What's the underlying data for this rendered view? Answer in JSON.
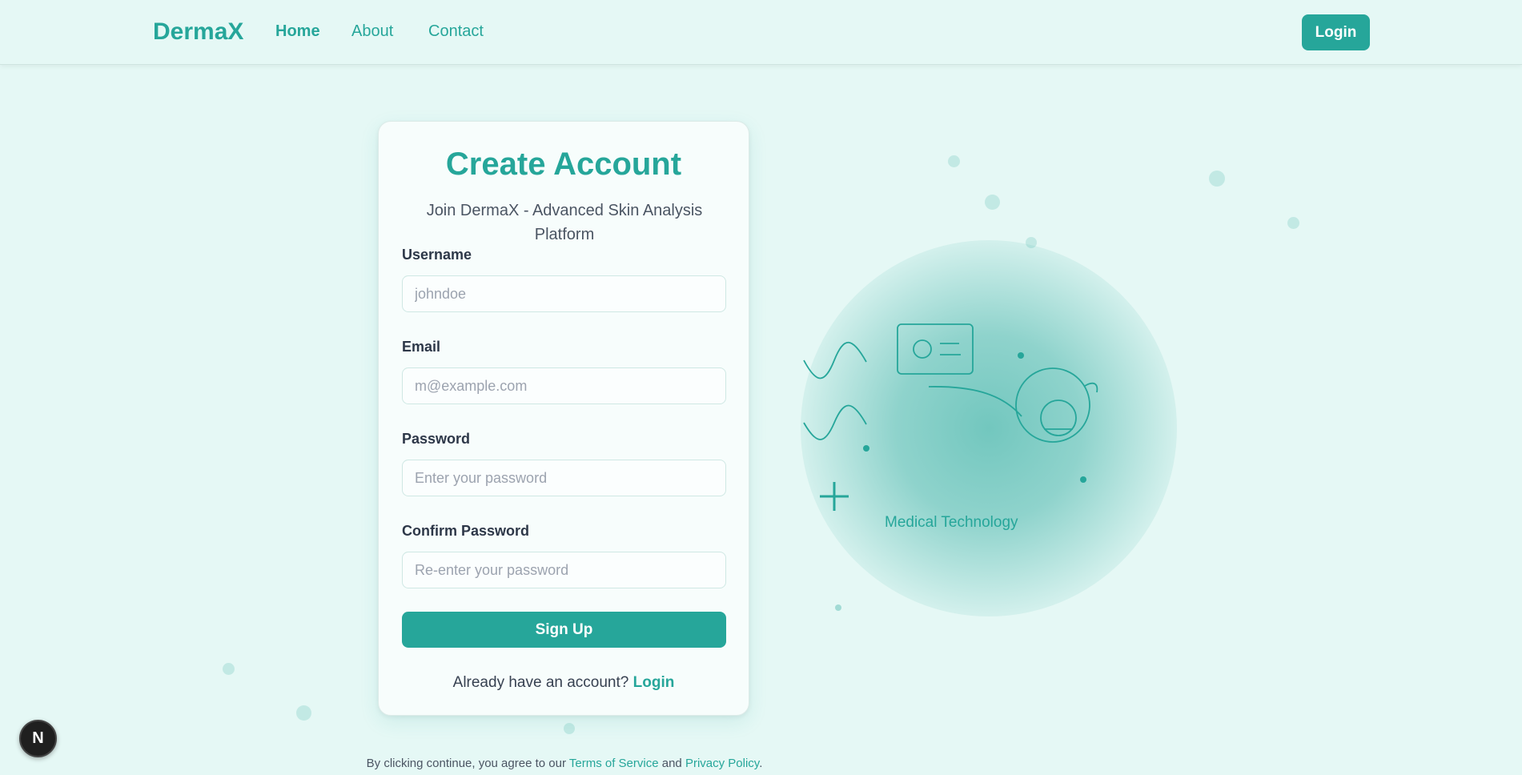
{
  "header": {
    "logo": "DermaX",
    "nav": {
      "home": "Home",
      "about": "About",
      "contact": "Contact"
    },
    "login_label": "Login"
  },
  "card": {
    "title": "Create Account",
    "subtitle": "Join DermaX - Advanced Skin Analysis Platform",
    "fields": [
      {
        "label": "Username",
        "placeholder": "johndoe",
        "value": ""
      },
      {
        "label": "Email",
        "placeholder": "m@example.com",
        "value": ""
      },
      {
        "label": "Password",
        "placeholder": "Enter your password",
        "value": ""
      },
      {
        "label": "Confirm Password",
        "placeholder": "Re-enter your password",
        "value": ""
      }
    ],
    "signup_label": "Sign Up",
    "already_text": "Already have an account?",
    "login_link": "Login"
  },
  "illustration": {
    "caption": "Medical Technology"
  },
  "footer": {
    "prefix": "By clicking continue, you agree to our",
    "terms": "Terms of Service",
    "and": "and",
    "privacy": "Privacy Policy",
    "suffix": "."
  },
  "badge": {
    "letter": "N"
  },
  "colors": {
    "accent": "#26a69a",
    "background": "#e5f8f5"
  },
  "icons": [
    "wave-icon",
    "id-card-icon",
    "face-scan-icon",
    "plus-icon",
    "nextjs-icon"
  ]
}
